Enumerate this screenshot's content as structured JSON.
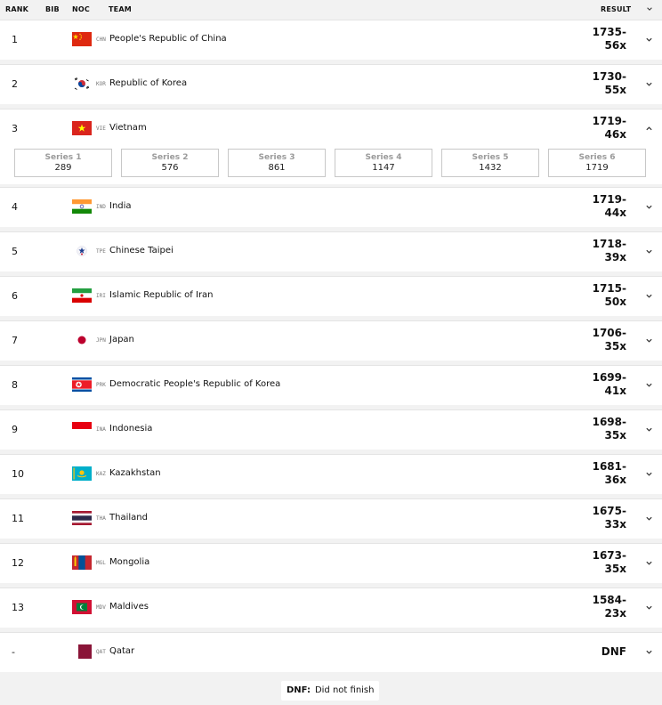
{
  "header": {
    "rank": "RANK",
    "bib": "BIB",
    "noc": "NOC",
    "team": "TEAM",
    "result": "RESULT"
  },
  "rows": [
    {
      "rank": "1",
      "noc": "CHN",
      "team": "People's Republic of China",
      "result_line1": "1735-",
      "result_line2": "56x",
      "flag": "chn"
    },
    {
      "rank": "2",
      "noc": "KOR",
      "team": "Republic of Korea",
      "result_line1": "1730-",
      "result_line2": "55x",
      "flag": "kor"
    },
    {
      "rank": "3",
      "noc": "VIE",
      "team": "Vietnam",
      "result_line1": "1719-",
      "result_line2": "46x",
      "flag": "vie",
      "expanded": true
    },
    {
      "rank": "4",
      "noc": "IND",
      "team": "India",
      "result_line1": "1719-",
      "result_line2": "44x",
      "flag": "ind"
    },
    {
      "rank": "5",
      "noc": "TPE",
      "team": "Chinese Taipei",
      "result_line1": "1718-",
      "result_line2": "39x",
      "flag": "tpe"
    },
    {
      "rank": "6",
      "noc": "IRI",
      "team": "Islamic Republic of Iran",
      "result_line1": "1715-",
      "result_line2": "50x",
      "flag": "iri"
    },
    {
      "rank": "7",
      "noc": "JPN",
      "team": "Japan",
      "result_line1": "1706-",
      "result_line2": "35x",
      "flag": "jpn"
    },
    {
      "rank": "8",
      "noc": "PRK",
      "team": "Democratic People's Republic of Korea",
      "result_line1": "1699-",
      "result_line2": "41x",
      "flag": "prk"
    },
    {
      "rank": "9",
      "noc": "INA",
      "team": "Indonesia",
      "result_line1": "1698-",
      "result_line2": "35x",
      "flag": "ina"
    },
    {
      "rank": "10",
      "noc": "KAZ",
      "team": "Kazakhstan",
      "result_line1": "1681-",
      "result_line2": "36x",
      "flag": "kaz"
    },
    {
      "rank": "11",
      "noc": "THA",
      "team": "Thailand",
      "result_line1": "1675-",
      "result_line2": "33x",
      "flag": "tha"
    },
    {
      "rank": "12",
      "noc": "MGL",
      "team": "Mongolia",
      "result_line1": "1673-",
      "result_line2": "35x",
      "flag": "mgl"
    },
    {
      "rank": "13",
      "noc": "MDV",
      "team": "Maldives",
      "result_line1": "1584-",
      "result_line2": "23x",
      "flag": "mdv"
    },
    {
      "rank": "-",
      "noc": "QAT",
      "team": "Qatar",
      "result_line1": "DNF",
      "result_line2": "",
      "flag": "qat"
    }
  ],
  "series_detail": [
    {
      "label": "Series 1",
      "value": "289"
    },
    {
      "label": "Series 2",
      "value": "576"
    },
    {
      "label": "Series 3",
      "value": "861"
    },
    {
      "label": "Series 4",
      "value": "1147"
    },
    {
      "label": "Series 5",
      "value": "1432"
    },
    {
      "label": "Series 6",
      "value": "1719"
    }
  ],
  "legend": {
    "abbr": "DNF:",
    "text": "Did not finish"
  },
  "colors": {
    "page_bg": "#f2f2f2",
    "row_bg": "#ffffff",
    "divider": "#e4e4e4",
    "series_label": "#9a9a9a"
  },
  "icons": {
    "row_toggle": "chevron-down-icon",
    "expanded_toggle": "chevron-up-icon"
  }
}
